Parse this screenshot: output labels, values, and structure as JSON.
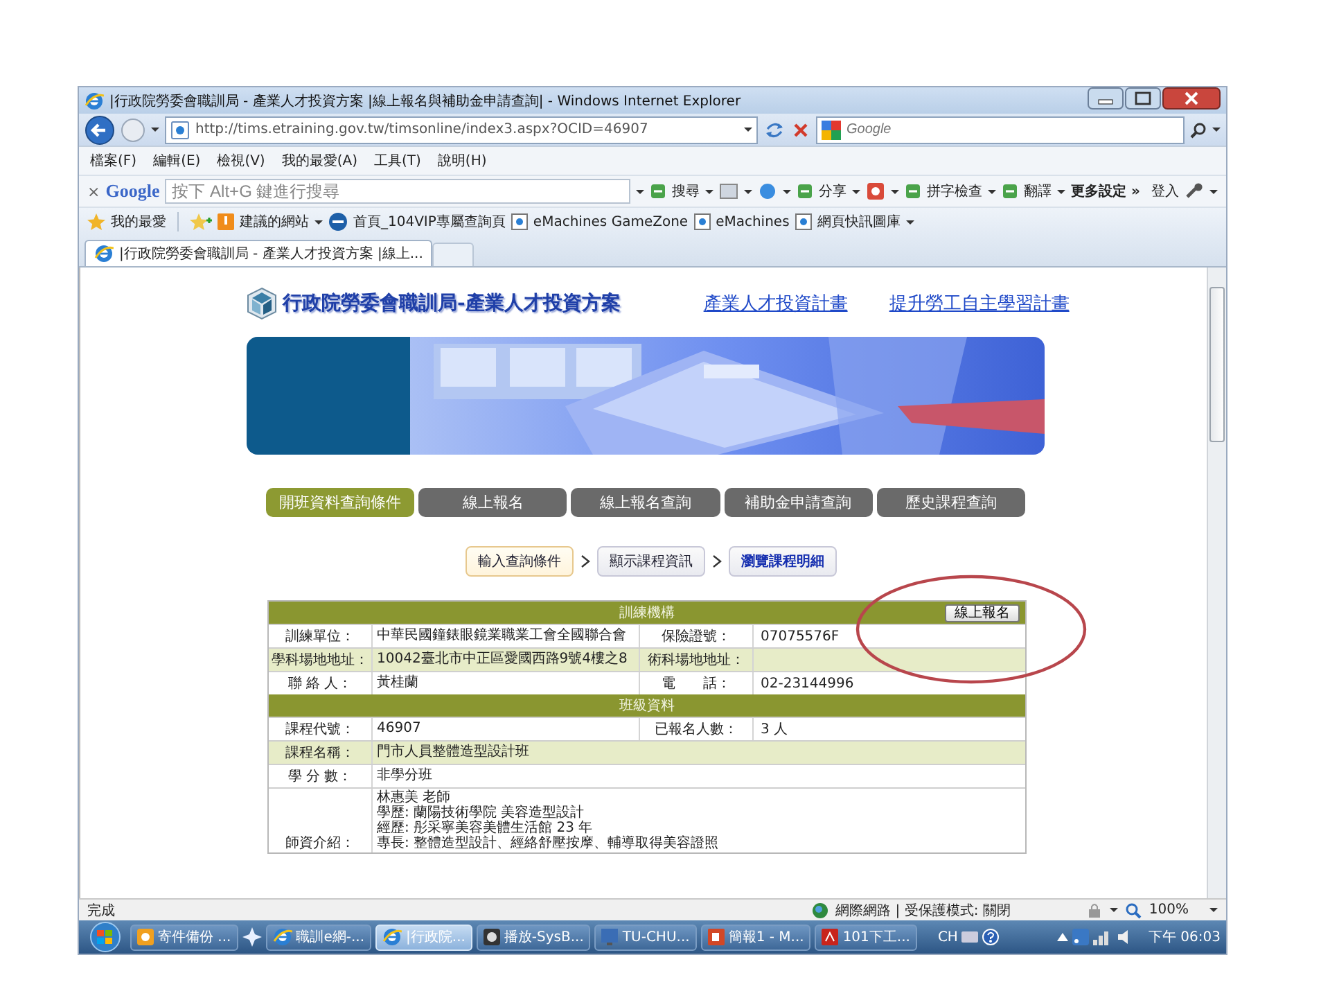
{
  "window": {
    "title": "|行政院勞委會職訓局 - 產業人才投資方案 |線上報名與補助金申請查詢| - Windows Internet Explorer"
  },
  "address_bar": {
    "url": "http://tims.etraining.gov.tw/timsonline/index3.aspx?OCID=46907"
  },
  "search": {
    "placeholder": "Google"
  },
  "menu": [
    "檔案(F)",
    "編輯(E)",
    "檢視(V)",
    "我的最愛(A)",
    "工具(T)",
    "說明(H)"
  ],
  "google_toolbar": {
    "close": "×",
    "logo": "Google",
    "placeholder": "按下 Alt+G 鍵進行搜尋",
    "items": [
      {
        "kind": "menu",
        "label": "搜尋"
      },
      {
        "kind": "icon_menu"
      },
      {
        "kind": "icon_menu"
      },
      {
        "kind": "menu",
        "label": "分享"
      },
      {
        "kind": "icon_menu"
      },
      {
        "kind": "menu",
        "label": "拼字檢查"
      },
      {
        "kind": "menu",
        "label": "翻譯"
      },
      {
        "kind": "link",
        "label": "更多設定 »"
      }
    ],
    "sign_in": "登入"
  },
  "favorites": {
    "label": "我的最愛",
    "links": [
      {
        "kind": "menu",
        "label": "建議的網站"
      },
      {
        "kind": "link",
        "label": "首頁_104VIP專屬查詢頁"
      },
      {
        "kind": "link",
        "label": "eMachines GameZone"
      },
      {
        "kind": "link",
        "label": "eMachines"
      },
      {
        "kind": "menu",
        "label": "網頁快訊圖庫"
      }
    ]
  },
  "tabs": [
    {
      "label": "|行政院勞委會職訓局 - 產業人才投資方案 |線上...",
      "selected": true
    }
  ],
  "site": {
    "logo": "行政院勞委會職訓局-產業人才投資方案",
    "links": [
      "產業人才投資計畫",
      "提升勞工自主學習計畫"
    ],
    "nav": [
      {
        "label": "開班資料查詢條件",
        "selected": true
      },
      {
        "label": "線上報名",
        "selected": false
      },
      {
        "label": "線上報名查詢",
        "selected": false
      },
      {
        "label": "補助金申請查詢",
        "selected": false
      },
      {
        "label": "歷史課程查詢",
        "selected": false
      }
    ],
    "steps": [
      {
        "label": "輸入查詢條件",
        "selected": false
      },
      {
        "label": "顯示課程資訊",
        "selected": false
      },
      {
        "label": "瀏覽課程明細",
        "selected": true
      }
    ]
  },
  "sections": [
    {
      "title": "訓練機構",
      "button": "線上報名",
      "rows": [
        {
          "shaded": false,
          "label": "訓練單位：",
          "value": "中華民國鐘錶眼鏡業職業工會全國聯合會",
          "label_2": "保險證號：",
          "value_2": "07075576F"
        },
        {
          "shaded": true,
          "label": "學科場地地址：",
          "value": "10042臺北市中正區愛國西路9號4樓之8",
          "label_2": "術科場地地址："
        },
        {
          "shaded": false,
          "label": "聯 絡 人：",
          "value": "黃桂蘭",
          "label_2": "電　　話：",
          "value_2": "02-23144996"
        }
      ]
    },
    {
      "title": "班級資料",
      "rows": [
        {
          "shaded": false,
          "label": "課程代號：",
          "value": "46907",
          "label_2": "已報名人數：",
          "value_2": "3 人"
        },
        {
          "shaded": true,
          "label": "課程名稱：",
          "value": "門市人員整體造型設計班"
        },
        {
          "shaded": false,
          "label": "學 分 數：",
          "value": "非學分班"
        },
        {
          "shaded": false,
          "label": "師資介紹：",
          "lines": [
            "林惠美 老師",
            "學歷: 蘭陽技術學院 美容造型設計",
            "經歷: 彤采寧美容美體生活館 23 年",
            "專長: 整體造型設計、經絡舒壓按摩、輔導取得美容證照"
          ]
        }
      ]
    }
  ],
  "status_bar": {
    "text": "完成",
    "zone": "網際網路 | 受保護模式: 關閉",
    "zoom": "100%"
  },
  "taskbar": {
    "items": [
      {
        "label": "寄件備份 ...",
        "selected": false
      },
      {
        "label": "職訓e網-...",
        "selected": false
      },
      {
        "label": "|行政院...",
        "selected": true
      },
      {
        "label": "播放-SysB...",
        "selected": false
      },
      {
        "label": "TU-CHU...",
        "selected": false
      },
      {
        "label": "簡報1 - M...",
        "selected": false
      },
      {
        "label": "101下工...",
        "selected": false
      }
    ],
    "language": "CH",
    "clock": "下午 06:03"
  }
}
